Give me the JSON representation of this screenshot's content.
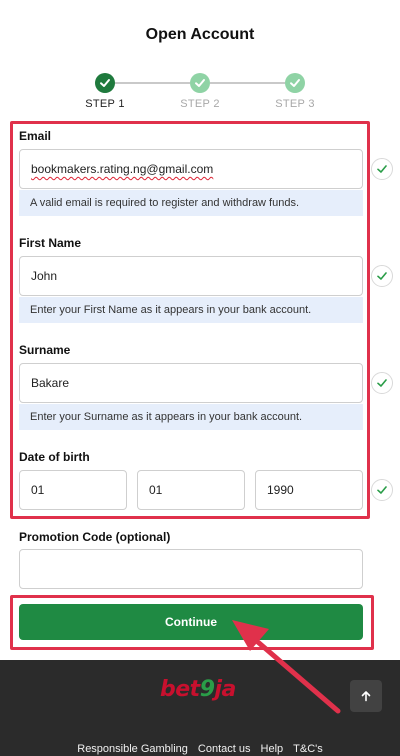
{
  "page": {
    "title": "Open Account"
  },
  "stepper": {
    "steps": [
      {
        "label": "STEP 1",
        "state": "done"
      },
      {
        "label": "STEP 2",
        "state": "pending"
      },
      {
        "label": "STEP 3",
        "state": "pending"
      }
    ]
  },
  "form": {
    "email": {
      "label": "Email",
      "value": "bookmakers.rating.ng@gmail.com",
      "helper": "A valid email is required to register and withdraw funds.",
      "valid": true
    },
    "first_name": {
      "label": "First Name",
      "value": "John",
      "helper": "Enter your First Name as it appears in your bank account.",
      "valid": true
    },
    "surname": {
      "label": "Surname",
      "value": "Bakare",
      "helper": "Enter your Surname as it appears in your bank account.",
      "valid": true
    },
    "dob": {
      "label": "Date of birth",
      "day": "01",
      "month": "01",
      "year": "1990",
      "valid": true
    },
    "promo": {
      "label": "Promotion Code (optional)",
      "value": ""
    },
    "continue_label": "Continue"
  },
  "footer": {
    "logo": {
      "bet": "bet",
      "nine": "9",
      "ja": "ja"
    },
    "links": [
      "Responsible Gambling",
      "Contact us",
      "Help",
      "T&C's"
    ]
  },
  "colors": {
    "brand_green": "#1f8a43",
    "highlight_red": "#e0314b",
    "helper_bg": "#e6eefb",
    "check_green": "#2a9d48"
  }
}
